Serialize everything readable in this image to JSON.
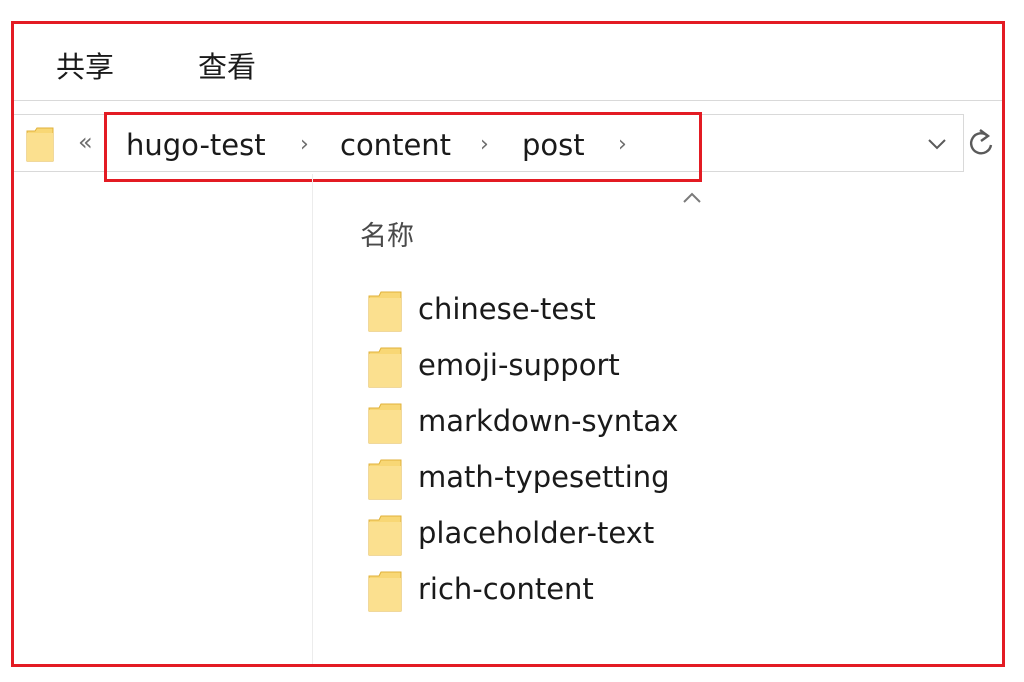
{
  "ribbon": {
    "tabs": [
      {
        "label": "共享"
      },
      {
        "label": "查看"
      }
    ]
  },
  "address_bar": {
    "overflow_glyph": "«",
    "breadcrumbs": [
      {
        "label": "hugo-test"
      },
      {
        "label": "content"
      },
      {
        "label": "post"
      }
    ],
    "separator": "›"
  },
  "column_header": {
    "name_label": "名称"
  },
  "files": [
    {
      "name": "chinese-test",
      "icon": "folder-icon"
    },
    {
      "name": "emoji-support",
      "icon": "folder-icon"
    },
    {
      "name": "markdown-syntax",
      "icon": "folder-icon"
    },
    {
      "name": "math-typesetting",
      "icon": "folder-icon"
    },
    {
      "name": "placeholder-text",
      "icon": "folder-icon"
    },
    {
      "name": "rich-content",
      "icon": "folder-icon"
    }
  ],
  "colors": {
    "highlight_border": "#e31b23",
    "folder_fill": "#f8d775",
    "folder_edge": "#e0b23a"
  }
}
